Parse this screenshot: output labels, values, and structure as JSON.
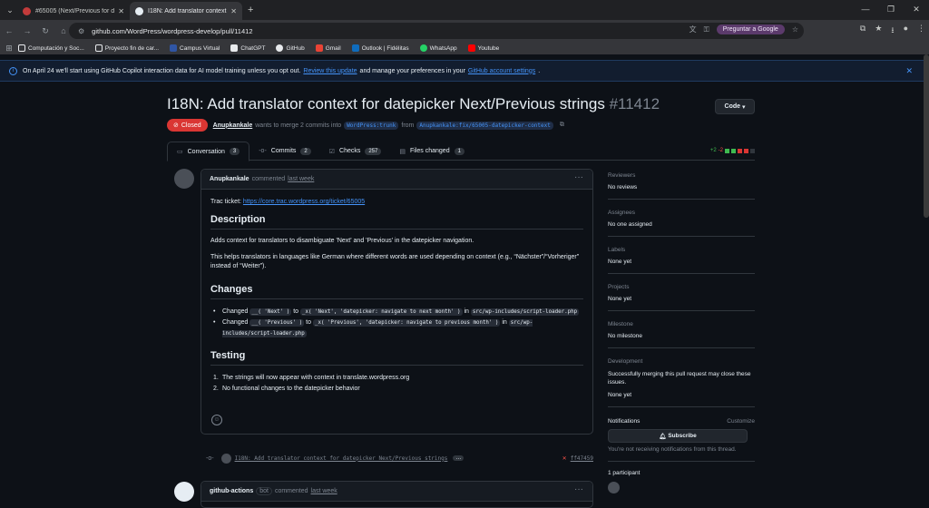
{
  "browser": {
    "tabs": [
      {
        "title": "#65005 (Next/Previous for date",
        "active": false
      },
      {
        "title": "I18N: Add translator context fo",
        "active": true
      }
    ],
    "url": "github.com/WordPress/wordpress-develop/pull/11412",
    "ask_google": "Preguntar a Google",
    "bookmarks": [
      "Computación y Soc...",
      "Proyecto fin de car...",
      "Campus Virtual",
      "ChatGPT",
      "GitHub",
      "Gmail",
      "Outlook | Fidélitas",
      "WhatsApp",
      "Youtube"
    ]
  },
  "banner": {
    "text_before": "On April 24 we'll start using GitHub Copilot interaction data for AI model training unless you opt out.",
    "link1": "Review this update",
    "text_mid": "and manage your preferences in your",
    "link2": "GitHub account settings",
    "text_end": "."
  },
  "pr": {
    "title": "I18N: Add translator context for datepicker Next/Previous strings",
    "number": "#11412",
    "code_label": "Code",
    "state": "Closed",
    "author": "Anupkankale",
    "merge_text": "wants to merge 2 commits into",
    "base_branch": "WordPress:trunk",
    "from_text": "from",
    "head_branch": "Anupkankale:fix/65005-datepicker-context"
  },
  "tabs": [
    {
      "label": "Conversation",
      "count": "3"
    },
    {
      "label": "Commits",
      "count": "2"
    },
    {
      "label": "Checks",
      "count": "257"
    },
    {
      "label": "Files changed",
      "count": "1"
    }
  ],
  "diffstat": {
    "plus": "+2",
    "minus": "-2"
  },
  "comment": {
    "author": "Anupkankale",
    "action": "commented",
    "time": "last week",
    "trac_label": "Trac ticket:",
    "trac_link": "https://core.trac.wordpress.org/ticket/65005",
    "h_description": "Description",
    "desc_p1": "Adds context for translators to disambiguate 'Next' and 'Previous' in the datepicker navigation.",
    "desc_p2": "This helps translators in languages like German where different words are used depending on context (e.g., “Nächster”/“Vorheriger” instead of “Weiter”).",
    "h_changes": "Changes",
    "changes": [
      {
        "prefix": "Changed",
        "from": "__( 'Next' )",
        "to_word": "to",
        "to": "_x( 'Next', 'datepicker: navigate to next month' )",
        "in_word": "in",
        "file": "src/wp-includes/script-loader.php"
      },
      {
        "prefix": "Changed",
        "from": "__( 'Previous' )",
        "to_word": "to",
        "to": "_x( 'Previous', 'datepicker: navigate to previous month' )",
        "in_word": "in",
        "file": "src/wp-includes/script-loader.php"
      }
    ],
    "h_testing": "Testing",
    "testing": [
      "The strings will now appear with context in translate.wordpress.org",
      "No functional changes to the datepicker behavior"
    ]
  },
  "commit_row": {
    "message": "I18N: Add translator context for datepicker Next/Previous strings",
    "ellipsis": "…",
    "sha": "ff47459"
  },
  "second_comment": {
    "author": "github-actions",
    "bot": "bot",
    "action": "commented",
    "time": "last week"
  },
  "sidebar": {
    "reviewers": {
      "label": "Reviewers",
      "value": "No reviews"
    },
    "assignees": {
      "label": "Assignees",
      "value": "No one assigned"
    },
    "labels": {
      "label": "Labels",
      "value": "None yet"
    },
    "projects": {
      "label": "Projects",
      "value": "None yet"
    },
    "milestone": {
      "label": "Milestone",
      "value": "No milestone"
    },
    "development": {
      "label": "Development",
      "desc": "Successfully merging this pull request may close these issues.",
      "value": "None yet"
    },
    "notifications": {
      "label": "Notifications",
      "customize": "Customize",
      "subscribe": "Subscribe",
      "note": "You're not receiving notifications from this thread."
    },
    "participants": "1 participant"
  },
  "colors": {
    "closed": "#da3633",
    "link": "#4493f8",
    "bg": "#0d1117"
  }
}
